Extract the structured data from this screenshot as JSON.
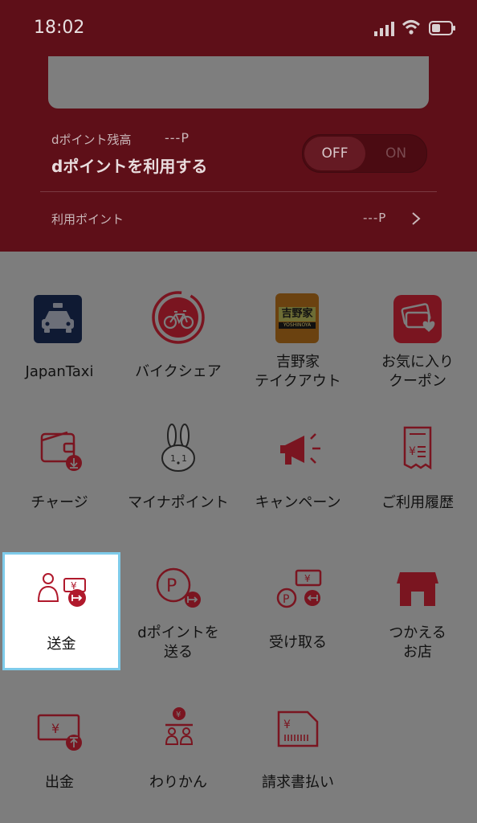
{
  "status_bar": {
    "time": "18:02"
  },
  "points": {
    "balance_label": "dポイント残高",
    "balance_value": "---P",
    "use_label": "dポイントを利用する",
    "toggle_off": "OFF",
    "toggle_on": "ON",
    "usage_label": "利用ポイント",
    "usage_value": "---P"
  },
  "menu": {
    "items": [
      {
        "label": "JapanTaxi",
        "icon": "taxi-icon"
      },
      {
        "label": "バイクシェア",
        "icon": "bicycle-icon"
      },
      {
        "label_line1": "吉野家",
        "label_line2": "テイクアウト",
        "icon": "yoshinoya-logo-icon",
        "logo_text": "吉野家",
        "logo_sub": "YOSHINOYA"
      },
      {
        "label_line1": "お気に入り",
        "label_line2": "クーポン",
        "icon": "coupon-heart-icon"
      },
      {
        "label": "チャージ",
        "icon": "wallet-charge-icon"
      },
      {
        "label": "マイナポイント",
        "icon": "rabbit-icon"
      },
      {
        "label": "キャンペーン",
        "icon": "megaphone-icon"
      },
      {
        "label": "ご利用履歴",
        "icon": "receipt-icon"
      },
      {
        "label": "送金",
        "icon": "send-money-icon"
      },
      {
        "label_line1": "dポイントを",
        "label_line2": "送る",
        "icon": "send-points-icon"
      },
      {
        "label": "受け取る",
        "icon": "receive-icon"
      },
      {
        "label_line1": "つかえる",
        "label_line2": "お店",
        "icon": "store-icon"
      },
      {
        "label": "出金",
        "icon": "withdraw-icon"
      },
      {
        "label": "わりかん",
        "icon": "split-bill-icon"
      },
      {
        "label": "請求書払い",
        "icon": "invoice-icon"
      }
    ]
  },
  "colors": {
    "accent": "#8a1a26",
    "overlay": "#7d7d7d",
    "highlight_border": "#7ecbea"
  }
}
